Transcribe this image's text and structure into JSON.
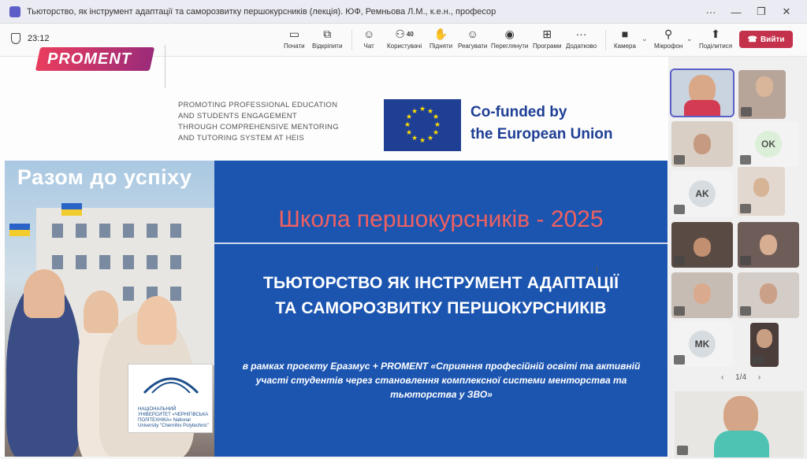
{
  "window": {
    "title": "Тьюторство, як інструмент адаптації та саморозвитку першокурсників (лекція). ЮФ, Ремньова Л.М., к.е.н., професор"
  },
  "toolbar": {
    "timer": "23:12",
    "items": [
      {
        "label": "Почати",
        "icon": "share-screen-icon"
      },
      {
        "label": "Відкріпити",
        "icon": "popout-icon"
      },
      {
        "label": "Чат",
        "icon": "chat-icon"
      },
      {
        "label": "Користувачі",
        "icon": "people-icon",
        "count": "40"
      },
      {
        "label": "Підняти",
        "icon": "raise-hand-icon"
      },
      {
        "label": "Реагувати",
        "icon": "react-icon"
      },
      {
        "label": "Переглянути",
        "icon": "view-icon"
      },
      {
        "label": "Програми",
        "icon": "apps-icon"
      },
      {
        "label": "Додатково",
        "icon": "more-icon"
      },
      {
        "label": "Камера",
        "icon": "camera-off-icon"
      },
      {
        "label": "Мікрофон",
        "icon": "mic-off-icon"
      },
      {
        "label": "Поділитися",
        "icon": "share-icon"
      }
    ],
    "leave_label": "Вийти"
  },
  "slide": {
    "proment_logo": "PROMENT",
    "proment_lines": [
      "PROMOTING PROFESSIONAL EDUCATION",
      "AND STUDENTS ENGAGEMENT",
      "THROUGH COMPREHENSIVE MENTORING",
      "AND TUTORING SYSTEM AT HEIS"
    ],
    "eu_line1": "Co-funded by",
    "eu_line2": "the European Union",
    "photo_caption": "Разом до успіху",
    "sign_text": "НАЦІОНАЛЬНИЙ УНІВЕРСИТЕТ «ЧЕРНІГІВСЬКА ПОЛІТЕХНІКА» National University \"Chernihiv Polytechnic\"",
    "school_title": "Школа першокурсників - 2025",
    "heading_line1": "ТЬЮТОРСТВО ЯК ІНСТРУМЕНТ АДАПТАЦІЇ",
    "heading_line2": "ТА САМОРОЗВИТКУ ПЕРШОКУРСНИКІВ",
    "sub_line1": "в рамках проєкту Еразмус + PROMENT «Сприяння професійній освіті та активній",
    "sub_line2": "участі  студентів через становлення комплексної системи менторства та",
    "sub_line3": "тьюторства  у ЗВО»"
  },
  "gallery": {
    "initials": [
      "OK",
      "AK",
      "MK"
    ],
    "pager": "1/4",
    "prev": "‹",
    "next": "›"
  },
  "colors": {
    "accent": "#5b5fc7",
    "leave": "#c4314b",
    "slide_blue": "#1c55b0",
    "title_red": "#f06060",
    "eu_blue": "#1f3f95"
  }
}
